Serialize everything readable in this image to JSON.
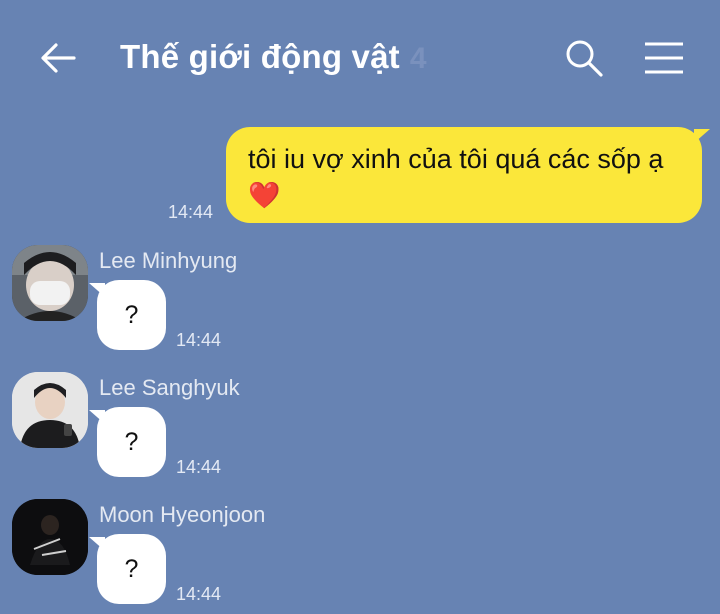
{
  "header": {
    "title": "Thế giới động vật",
    "member_count": "4"
  },
  "messages": {
    "outgoing": {
      "text": "tôi iu vợ xinh của tôi quá các sốp ạ",
      "emoji": "❤️",
      "time": "14:44"
    },
    "incoming": [
      {
        "sender": "Lee Minhyung",
        "text": "?",
        "time": "14:44"
      },
      {
        "sender": "Lee Sanghyuk",
        "text": "?",
        "time": "14:44"
      },
      {
        "sender": "Moon Hyeonjoon",
        "text": "?",
        "time": "14:44"
      }
    ]
  },
  "colors": {
    "background": "#6783b3",
    "outgoing_bubble": "#fbe73a",
    "incoming_bubble": "#ffffff"
  },
  "icons": [
    "back-arrow-icon",
    "search-icon",
    "menu-icon",
    "heart-emoji"
  ]
}
